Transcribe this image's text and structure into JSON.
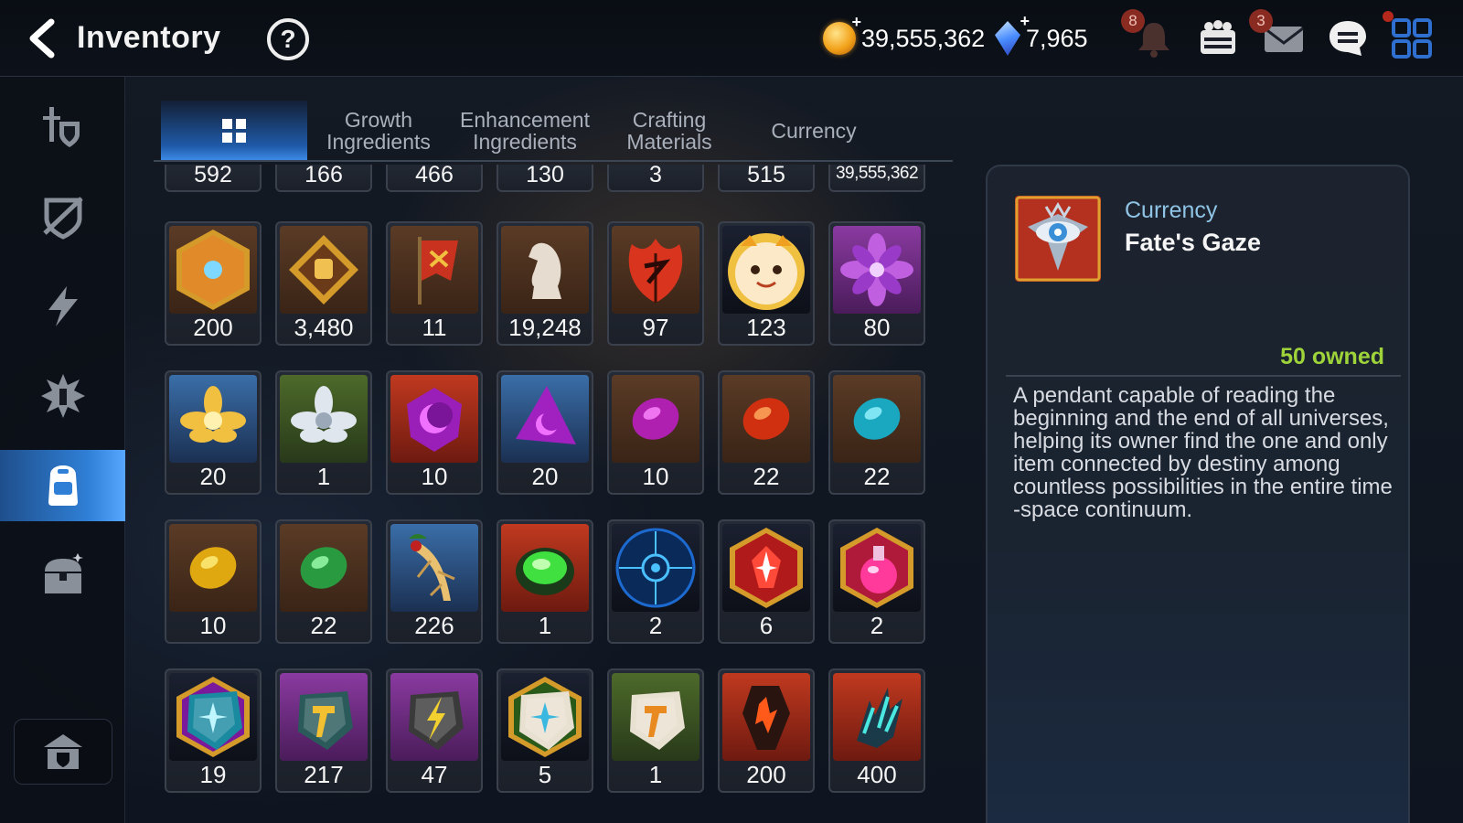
{
  "header": {
    "title": "Inventory",
    "help_icon": "question-circle-icon",
    "gold": "39,555,362",
    "crystal": "7,965",
    "notifications_badge": "8",
    "mail_badge": "3"
  },
  "sidebar": {
    "items": [
      {
        "icon": "sword-shield-icon"
      },
      {
        "icon": "broken-shield-icon"
      },
      {
        "icon": "lightning-icon"
      },
      {
        "icon": "spiky-emblem-icon"
      },
      {
        "icon": "backpack-icon",
        "active": true
      },
      {
        "icon": "treasure-chest-icon"
      }
    ],
    "guild_icon": "guild-hall-icon"
  },
  "tabs": [
    {
      "label": "",
      "icon": "grid-icon",
      "active": true
    },
    {
      "label": "Growth\nIngredients"
    },
    {
      "label": "Enhancement\nIngredients"
    },
    {
      "label": "Crafting\nMaterials"
    },
    {
      "label": "Currency"
    }
  ],
  "grid": {
    "top_row_counts": [
      "592",
      "166",
      "466",
      "130",
      "3",
      "515",
      "39,555,362"
    ],
    "rows": [
      [
        {
          "count": "200",
          "icon": "gold-hex-emblem"
        },
        {
          "count": "3,480",
          "icon": "fist-emblem"
        },
        {
          "count": "11",
          "icon": "red-banner"
        },
        {
          "count": "19,248",
          "icon": "knight-chess-piece"
        },
        {
          "count": "97",
          "icon": "red-leaf"
        },
        {
          "count": "123",
          "icon": "mascot-face"
        },
        {
          "count": "80",
          "icon": "purple-flower"
        }
      ],
      [
        {
          "count": "20",
          "icon": "gold-lotus"
        },
        {
          "count": "1",
          "icon": "silver-lotus"
        },
        {
          "count": "10",
          "icon": "purple-moon-gem"
        },
        {
          "count": "20",
          "icon": "purple-triangle-gem"
        },
        {
          "count": "10",
          "icon": "purple-oval-gem"
        },
        {
          "count": "22",
          "icon": "red-oval-gem"
        },
        {
          "count": "22",
          "icon": "cyan-oval-gem"
        }
      ],
      [
        {
          "count": "10",
          "icon": "yellow-oval-gem"
        },
        {
          "count": "22",
          "icon": "green-oval-gem"
        },
        {
          "count": "226",
          "icon": "golden-root"
        },
        {
          "count": "1",
          "icon": "green-pot"
        },
        {
          "count": "2",
          "icon": "blue-rune-disc"
        },
        {
          "count": "6",
          "icon": "red-hex-crystal"
        },
        {
          "count": "2",
          "icon": "pink-potion"
        }
      ],
      [
        {
          "count": "19",
          "icon": "purple-hex-stone"
        },
        {
          "count": "217",
          "icon": "purple-hammer-stone"
        },
        {
          "count": "47",
          "icon": "purple-bolt-stone"
        },
        {
          "count": "5",
          "icon": "green-hex-stone"
        },
        {
          "count": "1",
          "icon": "green-hammer-stone"
        },
        {
          "count": "200",
          "icon": "ember-stone"
        },
        {
          "count": "400",
          "icon": "teal-shards"
        }
      ]
    ]
  },
  "detail": {
    "category": "Currency",
    "name": "Fate's Gaze",
    "owned": "50 owned",
    "description": "A pendant capable of reading the beginning and the end of all universes, helping its owner find the one and only item connected by destiny among countless possibilities in the entire time -space continuum.",
    "icon": "eye-pendant-icon"
  },
  "colors": {
    "accent_blue": "#2f7fd6",
    "owned_green": "#9ed33a",
    "category_blue": "#8fc4e6"
  }
}
